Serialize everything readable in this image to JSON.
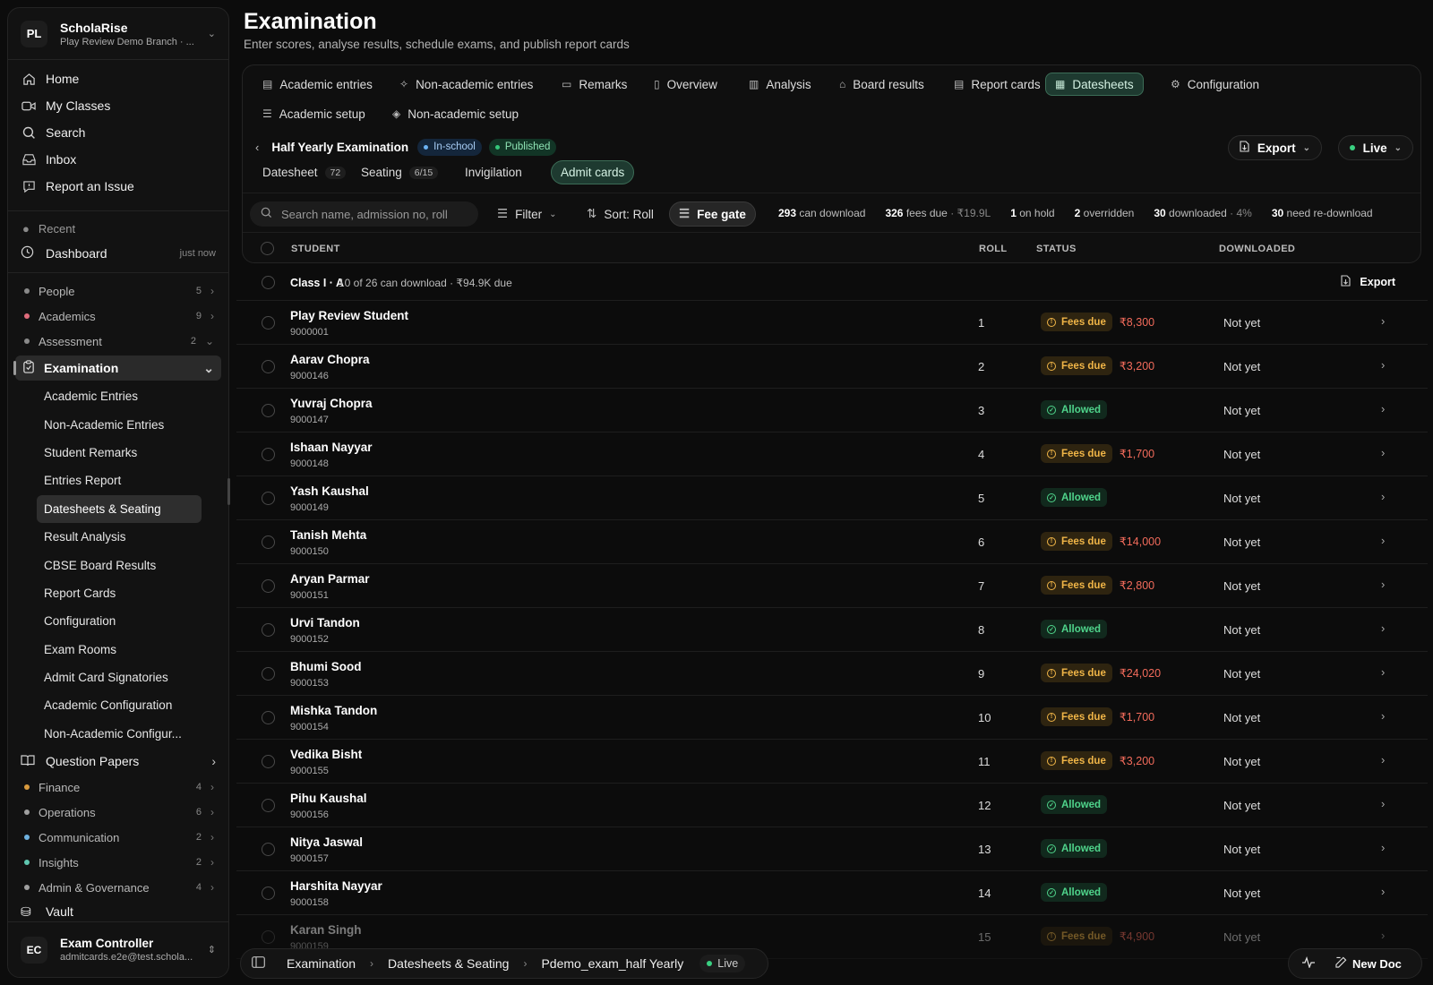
{
  "sidebar": {
    "org": {
      "initials": "PL",
      "name": "ScholaRise",
      "branch": "Play Review Demo Branch · ..."
    },
    "nav": [
      {
        "label": "Home",
        "icon": "home-icon"
      },
      {
        "label": "My Classes",
        "icon": "video-icon"
      },
      {
        "label": "Search",
        "icon": "search-icon"
      },
      {
        "label": "Inbox",
        "icon": "inbox-icon"
      },
      {
        "label": "Report an Issue",
        "icon": "report-icon"
      }
    ],
    "recent_label": "Recent",
    "recent_item": {
      "label": "Dashboard",
      "time": "just now"
    },
    "sections_top": [
      {
        "label": "People",
        "count": "5",
        "color": "#8a8a8a"
      },
      {
        "label": "Academics",
        "count": "9",
        "color": "#e06c7c"
      },
      {
        "label": "Assessment",
        "count": "2",
        "color": "#8a8a8a"
      }
    ],
    "examination": {
      "label": "Examination",
      "items": [
        {
          "label": "Academic Entries"
        },
        {
          "label": "Non-Academic Entries"
        },
        {
          "label": "Student Remarks"
        },
        {
          "label": "Entries Report"
        },
        {
          "label": "Datesheets & Seating"
        },
        {
          "label": "Result Analysis"
        },
        {
          "label": "CBSE Board Results"
        },
        {
          "label": "Report Cards"
        },
        {
          "label": "Configuration"
        },
        {
          "label": "Exam Rooms"
        },
        {
          "label": "Admit Card Signatories"
        },
        {
          "label": "Academic Configuration"
        },
        {
          "label": "Non-Academic Configur..."
        }
      ]
    },
    "question_papers": "Question Papers",
    "sections_bottom": [
      {
        "label": "Finance",
        "count": "4",
        "color": "#d99a3e"
      },
      {
        "label": "Operations",
        "count": "6",
        "color": "#a0a0a0"
      },
      {
        "label": "Communication",
        "count": "2",
        "color": "#6fb2e0"
      },
      {
        "label": "Insights",
        "count": "2",
        "color": "#5fc7b0"
      },
      {
        "label": "Admin & Governance",
        "count": "4",
        "color": "#a0a0a0"
      }
    ],
    "vault": "Vault",
    "user": {
      "initials": "EC",
      "name": "Exam Controller",
      "email": "admitcards.e2e@test.schola..."
    }
  },
  "header": {
    "title": "Examination",
    "subtitle": "Enter scores, analyse results, schedule exams, and publish report cards"
  },
  "tabs": [
    {
      "label": "Academic entries"
    },
    {
      "label": "Non-academic entries"
    },
    {
      "label": "Remarks"
    },
    {
      "label": "Overview"
    },
    {
      "label": "Analysis"
    },
    {
      "label": "Board results"
    },
    {
      "label": "Report cards"
    },
    {
      "label": "Datesheets"
    },
    {
      "label": "Configuration"
    },
    {
      "label": "Academic setup"
    },
    {
      "label": "Non-academic setup"
    }
  ],
  "exam": {
    "name": "Half Yearly Examination",
    "badge1": "In-school",
    "badge2": "Published",
    "export": "Export",
    "live": "Live"
  },
  "subtabs": [
    {
      "label": "Datesheet",
      "count": "72"
    },
    {
      "label": "Seating",
      "count": "6/15"
    },
    {
      "label": "Invigilation",
      "count": ""
    },
    {
      "label": "Admit cards",
      "count": ""
    }
  ],
  "toolbar": {
    "search_placeholder": "Search name, admission no, roll",
    "filter": "Filter",
    "sort": "Sort: Roll",
    "fee_gate": "Fee gate"
  },
  "stats": [
    {
      "value": "293",
      "label": "can download",
      "extra": ""
    },
    {
      "value": "326",
      "label": "fees due",
      "extra": "· ₹19.9L"
    },
    {
      "value": "1",
      "label": "on hold",
      "extra": ""
    },
    {
      "value": "2",
      "label": "overridden",
      "extra": ""
    },
    {
      "value": "30",
      "label": "downloaded",
      "extra": "· 4%"
    },
    {
      "value": "30",
      "label": "need re-download",
      "extra": ""
    }
  ],
  "columns": {
    "student": "STUDENT",
    "roll": "ROLL",
    "status": "STATUS",
    "downloaded": "DOWNLOADED"
  },
  "group": {
    "title": "Class I · A",
    "meta": "10 of 26 can download · ₹94.9K due",
    "export": "Export"
  },
  "students": [
    {
      "name": "Play Review Student",
      "adm": "9000001",
      "roll": "1",
      "status": "Fees due",
      "amount": "₹8,300",
      "downloaded": "Not yet"
    },
    {
      "name": "Aarav Chopra",
      "adm": "9000146",
      "roll": "2",
      "status": "Fees due",
      "amount": "₹3,200",
      "downloaded": "Not yet"
    },
    {
      "name": "Yuvraj Chopra",
      "adm": "9000147",
      "roll": "3",
      "status": "Allowed",
      "amount": "",
      "downloaded": "Not yet"
    },
    {
      "name": "Ishaan Nayyar",
      "adm": "9000148",
      "roll": "4",
      "status": "Fees due",
      "amount": "₹1,700",
      "downloaded": "Not yet"
    },
    {
      "name": "Yash Kaushal",
      "adm": "9000149",
      "roll": "5",
      "status": "Allowed",
      "amount": "",
      "downloaded": "Not yet"
    },
    {
      "name": "Tanish Mehta",
      "adm": "9000150",
      "roll": "6",
      "status": "Fees due",
      "amount": "₹14,000",
      "downloaded": "Not yet"
    },
    {
      "name": "Aryan Parmar",
      "adm": "9000151",
      "roll": "7",
      "status": "Fees due",
      "amount": "₹2,800",
      "downloaded": "Not yet"
    },
    {
      "name": "Urvi Tandon",
      "adm": "9000152",
      "roll": "8",
      "status": "Allowed",
      "amount": "",
      "downloaded": "Not yet"
    },
    {
      "name": "Bhumi Sood",
      "adm": "9000153",
      "roll": "9",
      "status": "Fees due",
      "amount": "₹24,020",
      "downloaded": "Not yet"
    },
    {
      "name": "Mishka Tandon",
      "adm": "9000154",
      "roll": "10",
      "status": "Fees due",
      "amount": "₹1,700",
      "downloaded": "Not yet"
    },
    {
      "name": "Vedika Bisht",
      "adm": "9000155",
      "roll": "11",
      "status": "Fees due",
      "amount": "₹3,200",
      "downloaded": "Not yet"
    },
    {
      "name": "Pihu Kaushal",
      "adm": "9000156",
      "roll": "12",
      "status": "Allowed",
      "amount": "",
      "downloaded": "Not yet"
    },
    {
      "name": "Nitya Jaswal",
      "adm": "9000157",
      "roll": "13",
      "status": "Allowed",
      "amount": "",
      "downloaded": "Not yet"
    },
    {
      "name": "Harshita Nayyar",
      "adm": "9000158",
      "roll": "14",
      "status": "Allowed",
      "amount": "",
      "downloaded": "Not yet"
    },
    {
      "name": "Karan Singh",
      "adm": "9000159",
      "roll": "15",
      "status": "Fees due",
      "amount": "₹4,900",
      "downloaded": "Not yet"
    }
  ],
  "bottombar": {
    "crumbs": [
      "Examination",
      "Datesheets & Seating",
      "Pdemo_exam_half Yearly"
    ],
    "live": "Live",
    "new_doc": "New Doc"
  }
}
